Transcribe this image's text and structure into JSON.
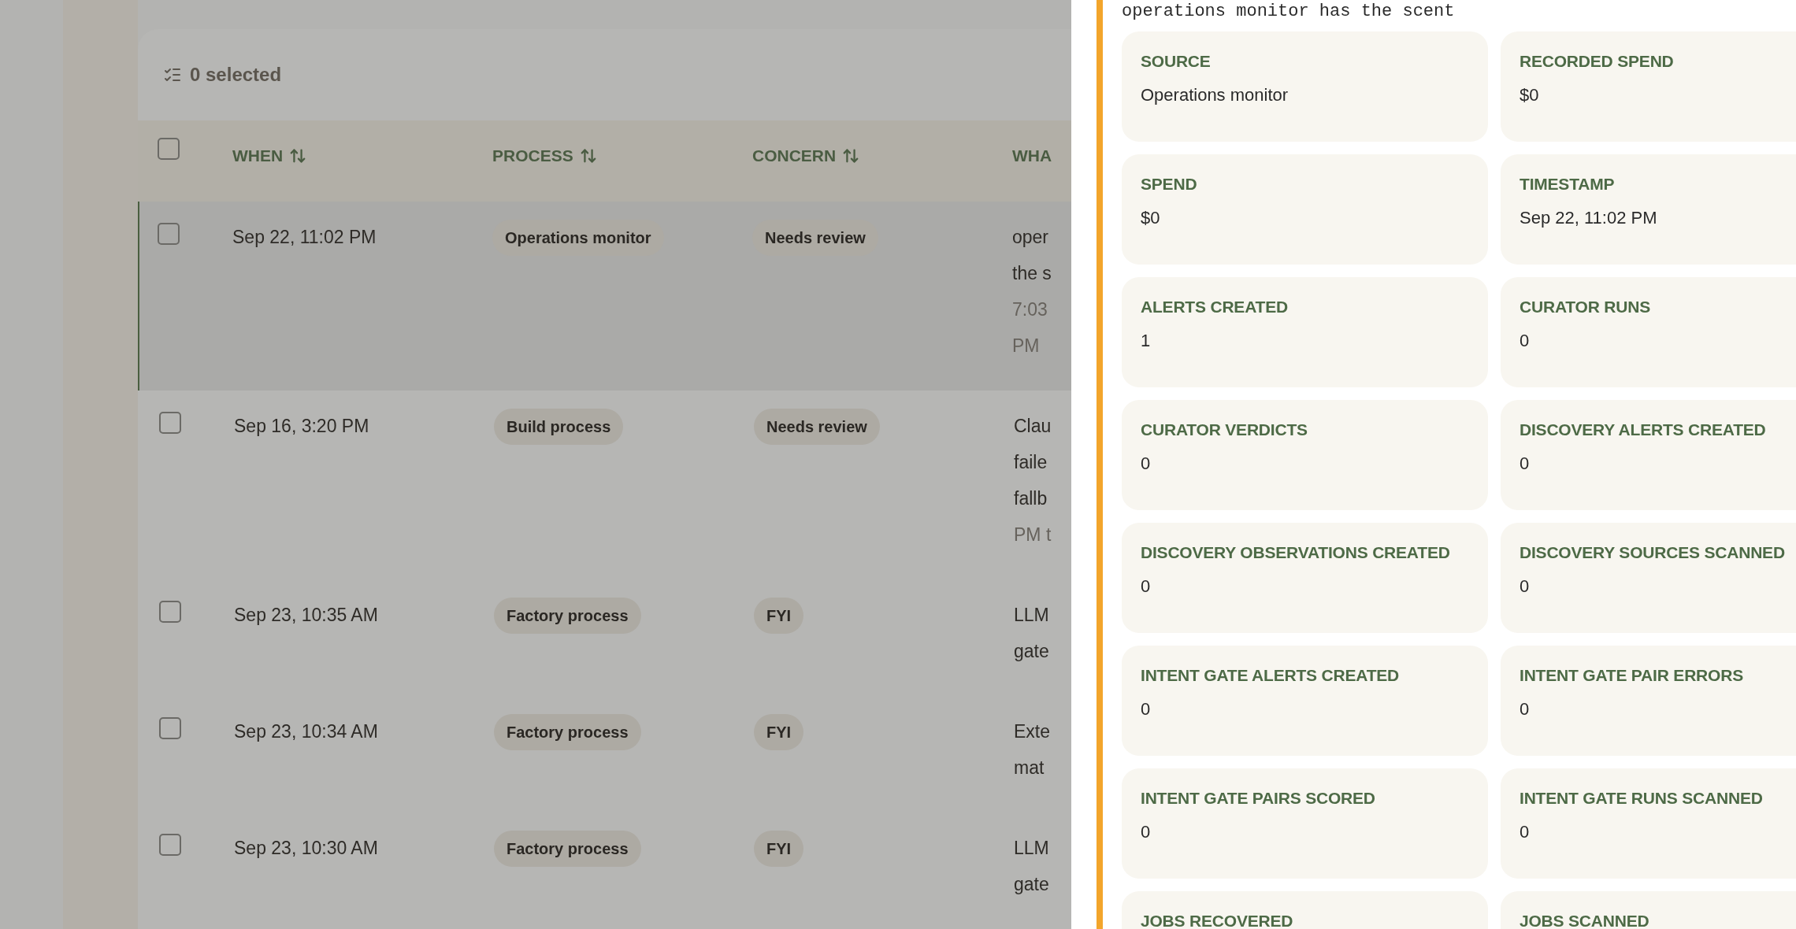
{
  "toolbar": {
    "selection_count": "0 selected"
  },
  "table": {
    "header_checkbox": {
      "checked": false
    },
    "columns": [
      {
        "label": "WHEN",
        "sortable": true
      },
      {
        "label": "PROCESS",
        "sortable": true
      },
      {
        "label": "CONCERN",
        "sortable": true
      },
      {
        "label": "WHA",
        "sortable": false
      }
    ],
    "rows": [
      {
        "checked": false,
        "selected": true,
        "when": "Sep 22, 11:02 PM",
        "process": "Operations monitor",
        "concern": "Needs review",
        "what": [
          {
            "text": "oper",
            "muted": false
          },
          {
            "text": "the s",
            "muted": false
          },
          {
            "text": "7:03",
            "muted": true
          },
          {
            "text": "PM",
            "muted": true
          }
        ]
      },
      {
        "checked": false,
        "selected": false,
        "when": "Sep 16, 3:20 PM",
        "process": "Build process",
        "concern": "Needs review",
        "what": [
          {
            "text": "Clau",
            "muted": false
          },
          {
            "text": "faile",
            "muted": false
          },
          {
            "text": "fallb",
            "muted": false
          },
          {
            "text": "PM t",
            "muted": true
          }
        ]
      },
      {
        "checked": false,
        "selected": false,
        "when": "Sep 23, 10:35 AM",
        "process": "Factory process",
        "concern": "FYI",
        "what": [
          {
            "text": "LLM",
            "muted": false
          },
          {
            "text": "gate",
            "muted": false
          }
        ]
      },
      {
        "checked": false,
        "selected": false,
        "when": "Sep 23, 10:34 AM",
        "process": "Factory process",
        "concern": "FYI",
        "what": [
          {
            "text": "Exte",
            "muted": false
          },
          {
            "text": "mat",
            "muted": false
          }
        ]
      },
      {
        "checked": false,
        "selected": false,
        "when": "Sep 23, 10:30 AM",
        "process": "Factory process",
        "concern": "FYI",
        "what": [
          {
            "text": "LLM",
            "muted": false
          },
          {
            "text": "gate",
            "muted": false
          }
        ]
      }
    ]
  },
  "drawer": {
    "summary": "operations monitor has the scent",
    "fields": [
      {
        "label": "SOURCE",
        "value": "Operations monitor"
      },
      {
        "label": "RECORDED SPEND",
        "value": "$0"
      },
      {
        "label": "SPEND",
        "value": "$0"
      },
      {
        "label": "TIMESTAMP",
        "value": "Sep 22, 11:02 PM"
      },
      {
        "label": "ALERTS CREATED",
        "value": "1"
      },
      {
        "label": "CURATOR RUNS",
        "value": "0"
      },
      {
        "label": "CURATOR VERDICTS",
        "value": "0"
      },
      {
        "label": "DISCOVERY ALERTS CREATED",
        "value": "0"
      },
      {
        "label": "DISCOVERY OBSERVATIONS CREATED",
        "value": "0"
      },
      {
        "label": "DISCOVERY SOURCES SCANNED",
        "value": "0"
      },
      {
        "label": "INTENT GATE ALERTS CREATED",
        "value": "0"
      },
      {
        "label": "INTENT GATE PAIR ERRORS",
        "value": "0"
      },
      {
        "label": "INTENT GATE PAIRS SCORED",
        "value": "0"
      },
      {
        "label": "INTENT GATE RUNS SCANNED",
        "value": "0"
      },
      {
        "label": "JOBS RECOVERED"
      },
      {
        "label": "JOBS SCANNED"
      }
    ]
  }
}
